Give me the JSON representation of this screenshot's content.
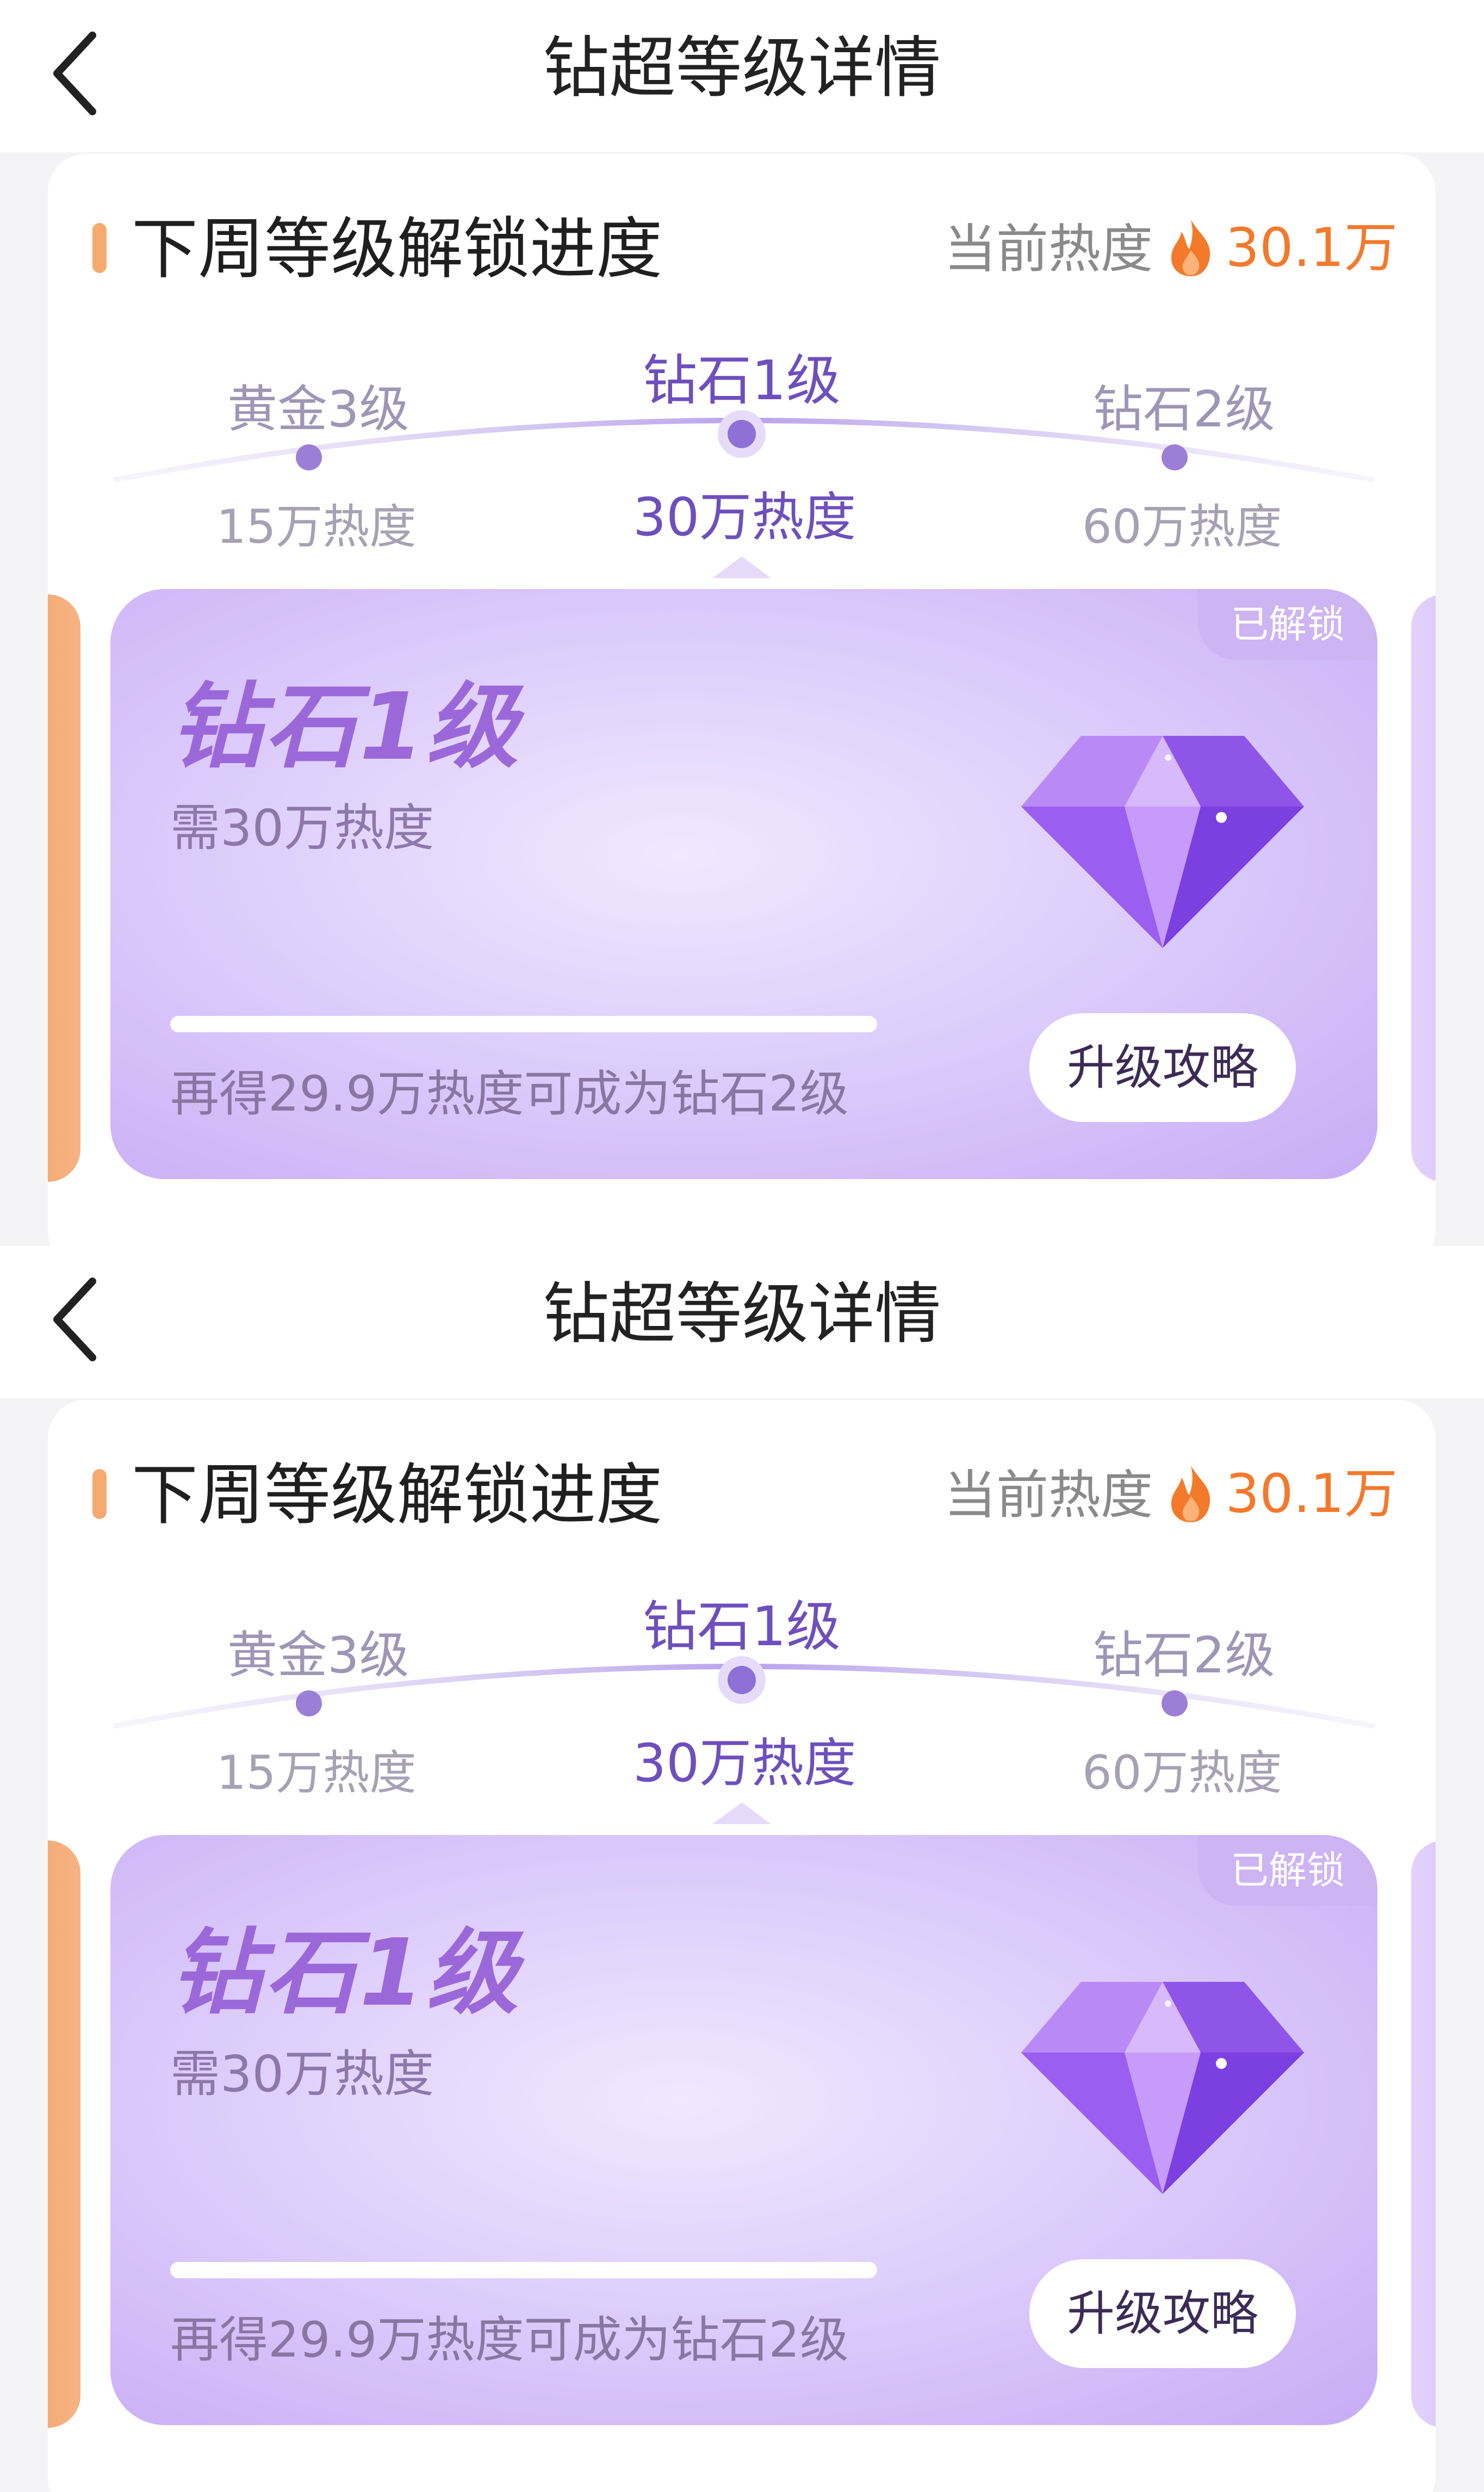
{
  "nav": {
    "title": "钻超等级详情"
  },
  "section": {
    "title": "下周等级解锁进度",
    "current_heat_label": "当前热度",
    "current_heat_value": "30.1万"
  },
  "levels": [
    {
      "name": "黄金3级",
      "heat": "15万热度"
    },
    {
      "name": "钻石1级",
      "heat": "30万热度"
    },
    {
      "name": "钻石2级",
      "heat": "60万热度"
    }
  ],
  "card": {
    "badge": "已解锁",
    "title": "钻石1级",
    "requirement": "需30万热度",
    "progress_fraction": 1.0,
    "hint": "再得29.9万热度可成为钻石2级",
    "strategy_button": "升级攻略"
  },
  "colors": {
    "accent_orange": "#f3792c",
    "purple": "#6e4fbd",
    "card_gradient_center": "#f1e8fe",
    "card_gradient_edge": "#c7acf5"
  },
  "icons": {
    "back": "chevron-left-icon",
    "flame": "flame-icon",
    "gem": "diamond-icon"
  }
}
